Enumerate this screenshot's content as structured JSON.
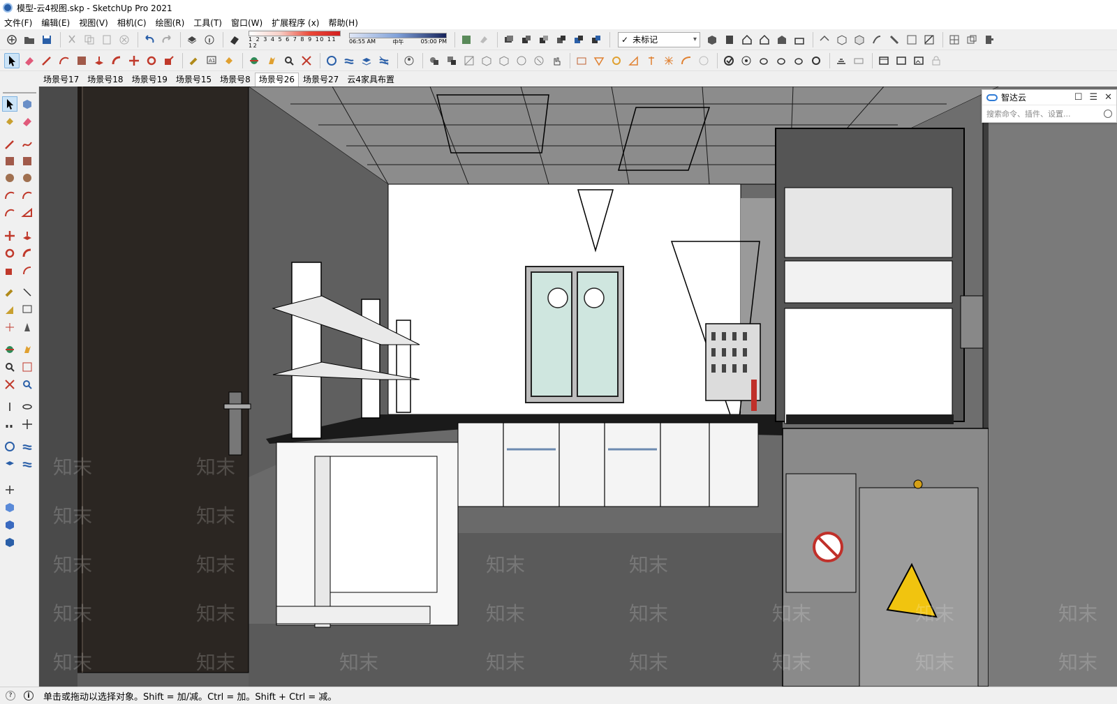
{
  "window": {
    "title": "模型-云4视图.skp - SketchUp Pro 2021"
  },
  "menu": [
    "文件(F)",
    "编辑(E)",
    "视图(V)",
    "相机(C)",
    "绘图(R)",
    "工具(T)",
    "窗口(W)",
    "扩展程序 (x)",
    "帮助(H)"
  ],
  "toolbar": {
    "shadow_months": "1 2 3 4 5 6 7 8 9 10 11 12",
    "time_start": "06:55 AM",
    "time_mid": "中午",
    "time_end": "05:00 PM",
    "tag_value": "未标记"
  },
  "scene_tabs": [
    "场景号17",
    "场景号18",
    "场景号19",
    "场景号15",
    "场景号8",
    "场景号26",
    "场景号27",
    "云4家具布置"
  ],
  "active_scene_index": 5,
  "panel": {
    "title": "智达云",
    "search_placeholder": "搜索命令、插件、设置..."
  },
  "status": {
    "text": "单击或拖动以选择对象。Shift = 加/减。Ctrl = 加。Shift + Ctrl = 减。"
  },
  "watermark": "知末",
  "colors": {
    "accent": "#2f7bd6",
    "viewport_bg": "#6a6a6a",
    "active_tool": "#cce4f7"
  }
}
